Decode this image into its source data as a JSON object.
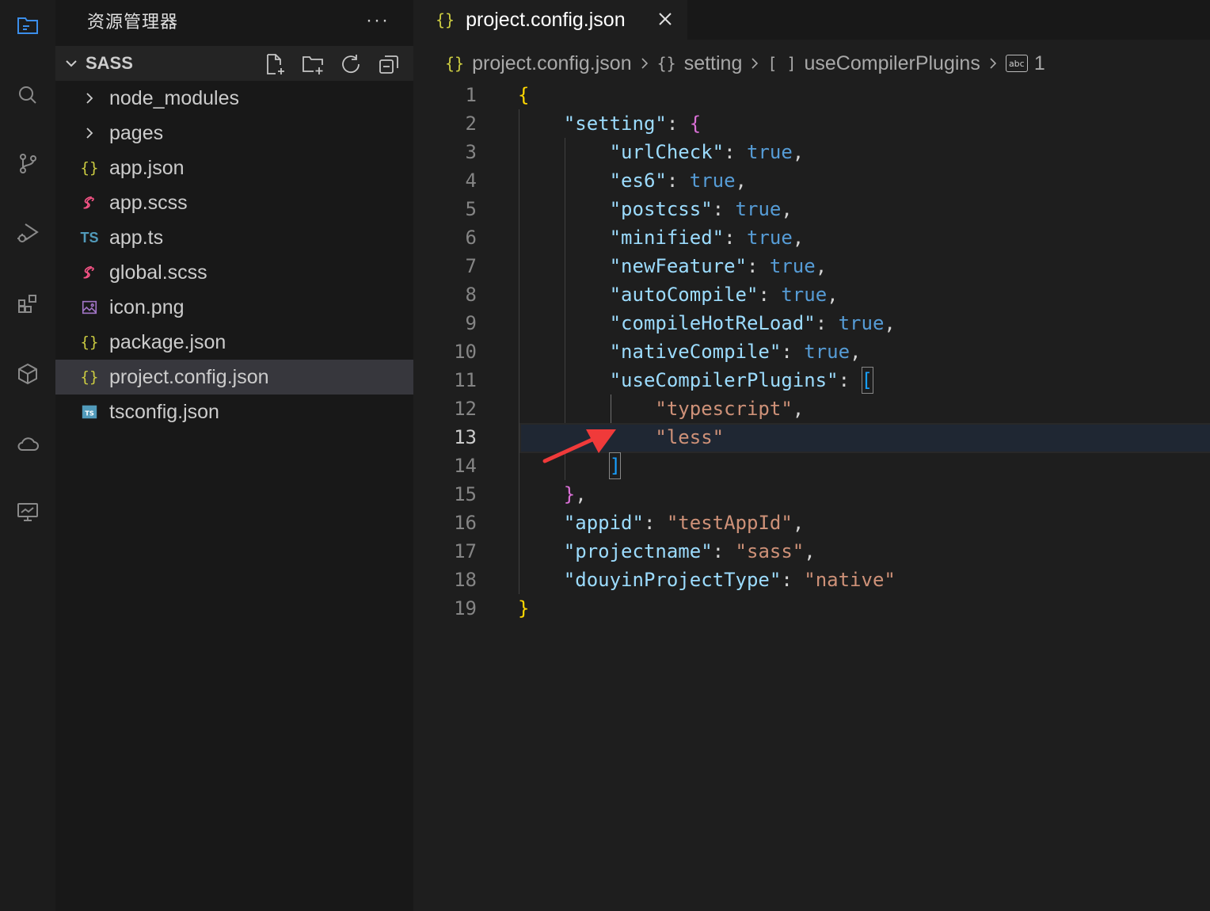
{
  "activity_bar": {
    "items": [
      {
        "name": "explorer-icon",
        "active": true
      },
      {
        "name": "search-icon"
      },
      {
        "name": "source-control-icon"
      },
      {
        "name": "run-debug-icon"
      },
      {
        "name": "extensions-icon"
      },
      {
        "name": "package-icon"
      },
      {
        "name": "cloud-icon"
      },
      {
        "name": "monitor-icon"
      }
    ]
  },
  "sidebar": {
    "title": "资源管理器",
    "more": "···",
    "section_title": "SASS",
    "tree": [
      {
        "label": "node_modules",
        "type": "folder"
      },
      {
        "label": "pages",
        "type": "folder"
      },
      {
        "label": "app.json",
        "type": "json",
        "icon_text": "{}"
      },
      {
        "label": "app.scss",
        "type": "scss"
      },
      {
        "label": "app.ts",
        "type": "ts",
        "icon_text": "TS"
      },
      {
        "label": "global.scss",
        "type": "scss"
      },
      {
        "label": "icon.png",
        "type": "image"
      },
      {
        "label": "package.json",
        "type": "json",
        "icon_text": "{}"
      },
      {
        "label": "project.config.json",
        "type": "json",
        "icon_text": "{}",
        "selected": true
      },
      {
        "label": "tsconfig.json",
        "type": "tsconfig"
      }
    ]
  },
  "editor": {
    "tab": {
      "label": "project.config.json",
      "icon_text": "{}"
    },
    "breadcrumb": {
      "file": "project.config.json",
      "file_icon": "{}",
      "setting": "setting",
      "setting_icon": "{}",
      "plugins": "useCompilerPlugins",
      "plugins_icon": "[ ]",
      "item_icon": "abc",
      "item": "1"
    },
    "active_line": 13,
    "lines": [
      {
        "n": "1"
      },
      {
        "n": "2"
      },
      {
        "n": "3"
      },
      {
        "n": "4"
      },
      {
        "n": "5"
      },
      {
        "n": "6"
      },
      {
        "n": "7"
      },
      {
        "n": "8"
      },
      {
        "n": "9"
      },
      {
        "n": "10"
      },
      {
        "n": "11"
      },
      {
        "n": "12"
      },
      {
        "n": "13"
      },
      {
        "n": "14"
      },
      {
        "n": "15"
      },
      {
        "n": "16"
      },
      {
        "n": "17"
      },
      {
        "n": "18"
      },
      {
        "n": "19"
      }
    ],
    "code": {
      "open": "{",
      "setting_key": "\"setting\"",
      "colon": ": ",
      "open2": "{",
      "urlCheck_key": "\"urlCheck\"",
      "es6_key": "\"es6\"",
      "postcss_key": "\"postcss\"",
      "minified_key": "\"minified\"",
      "newFeature_key": "\"newFeature\"",
      "autoCompile_key": "\"autoCompile\"",
      "compileHotReLoad_key": "\"compileHotReLoad\"",
      "nativeCompile_key": "\"nativeCompile\"",
      "useCompilerPlugins_key": "\"useCompilerPlugins\"",
      "true_val": "true",
      "comma": ",",
      "open_arr": "[",
      "typescript_val": "\"typescript\"",
      "less_val": "\"less\"",
      "close_arr": "]",
      "close2": "}",
      "appid_key": "\"appid\"",
      "appid_val": "\"testAppId\"",
      "projectname_key": "\"projectname\"",
      "projectname_val": "\"sass\"",
      "douyin_key": "\"douyinProjectType\"",
      "douyin_val": "\"native\"",
      "close": "}"
    }
  },
  "colors": {
    "key": "#9cdcfe",
    "string": "#ce9178",
    "boolean": "#569cd6",
    "bracket_level1": "#ffd700",
    "bracket_level2": "#da70d6",
    "bracket_level3": "#179fff",
    "annotation_arrow": "#f03a3a"
  }
}
